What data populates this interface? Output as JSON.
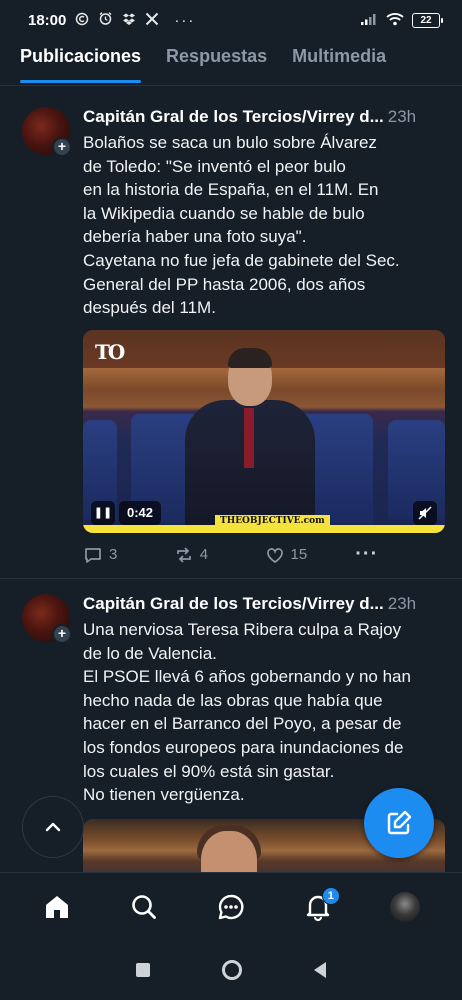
{
  "status_bar": {
    "time": "18:00",
    "icons": [
      "copyright-icon",
      "alarm-icon",
      "dropbox-icon",
      "x-logo-icon",
      "more-icon"
    ],
    "battery": "22"
  },
  "tabs": [
    {
      "label": "Publicaciones",
      "active": true
    },
    {
      "label": "Respuestas",
      "active": false
    },
    {
      "label": "Multimedia",
      "active": false
    }
  ],
  "posts": [
    {
      "author": "Capitán Gral de los Tercios/Virrey d...",
      "time": "23h",
      "text_lines": [
        "Bolaños se saca un bulo sobre Álvarez",
        "de Toledo: \"Se inventó el peor bulo",
        "en la historia de España, en el 11M. En",
        "la Wikipedia cuando se hable de bulo",
        "debería haber una foto suya\".",
        "Cayetana no fue jefa de gabinete del Sec.",
        "General del PP hasta 2006, dos años",
        "después del 11M."
      ],
      "media": {
        "logo": "TO",
        "duration": "0:42",
        "brand": "THEOBJECTIVE.com"
      },
      "actions": {
        "replies": "3",
        "reposts": "4",
        "likes": "15"
      }
    },
    {
      "author": "Capitán Gral de los Tercios/Virrey d...",
      "time": "23h",
      "text_lines": [
        "Una nerviosa Teresa Ribera culpa a Rajoy",
        "de lo de Valencia.",
        "El PSOE llevá 6 años gobernando y no han",
        "hecho nada de las obras que había que",
        "hacer en el Barranco del Poyo, a pesar de",
        "los fondos europeos para inundaciones de",
        "los cuales el 90% está sin gastar.",
        "No tienen vergüenza."
      ]
    }
  ],
  "bottom_nav": {
    "items": [
      "home-icon",
      "search-icon",
      "chat-icon",
      "notifications-icon",
      "profile-avatar"
    ],
    "notification_badge": "1"
  },
  "colors": {
    "background": "#161e27",
    "accent": "#1d8cf0",
    "muted": "#8b98a5"
  }
}
